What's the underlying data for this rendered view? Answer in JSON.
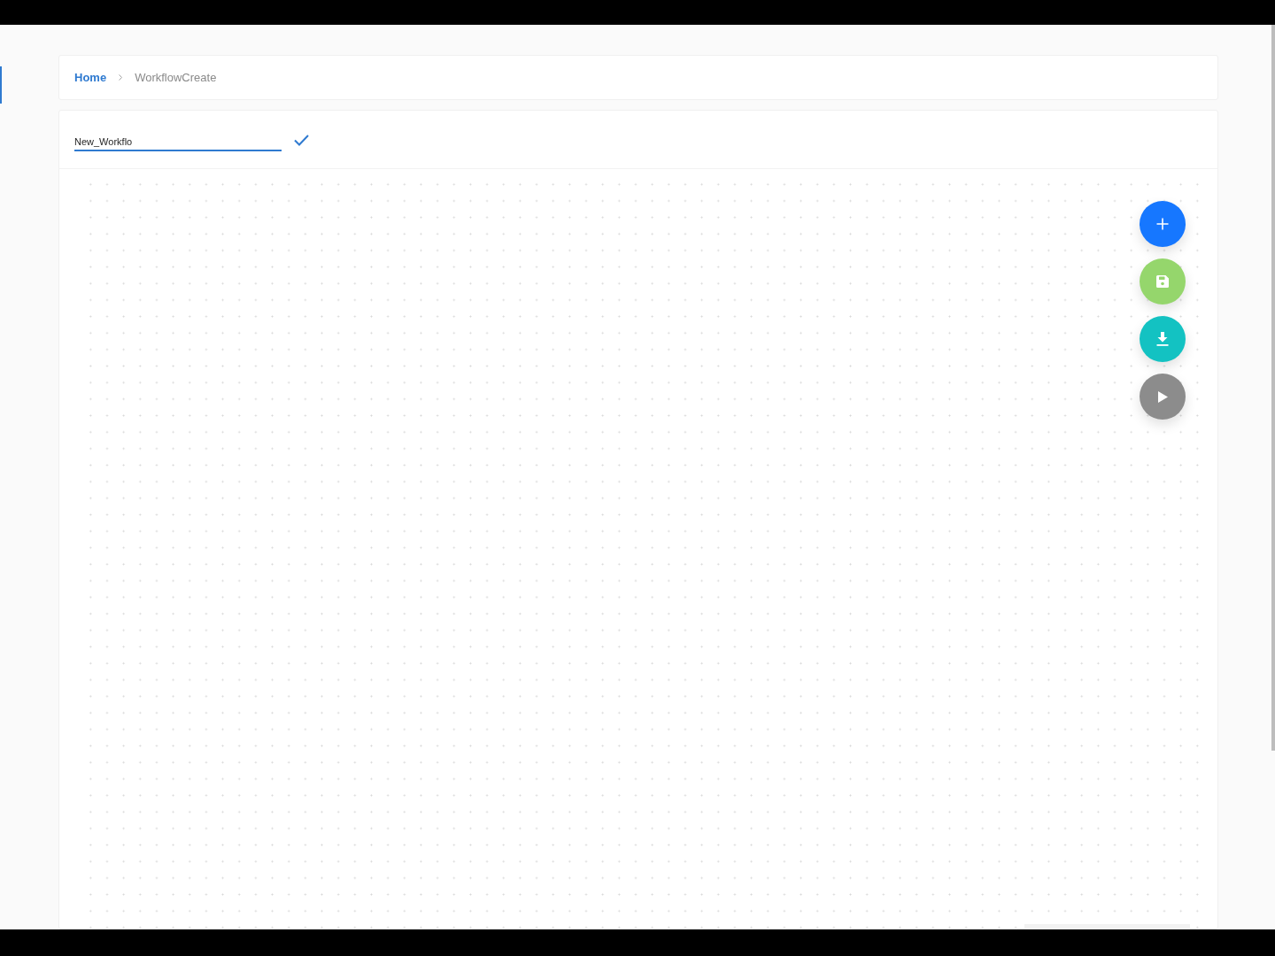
{
  "breadcrumb": [
    {
      "label": "Home",
      "current": false
    },
    {
      "label": "WorkflowCreate",
      "current": true
    }
  ],
  "name_field": {
    "value": "New_Workflo",
    "focused": true
  },
  "actions": [
    {
      "kind": "add",
      "color": "#1677ff"
    },
    {
      "kind": "save",
      "color": "#95d66c"
    },
    {
      "kind": "download",
      "color": "#13c2c2"
    },
    {
      "kind": "run",
      "color": "#8c8c8c"
    }
  ]
}
